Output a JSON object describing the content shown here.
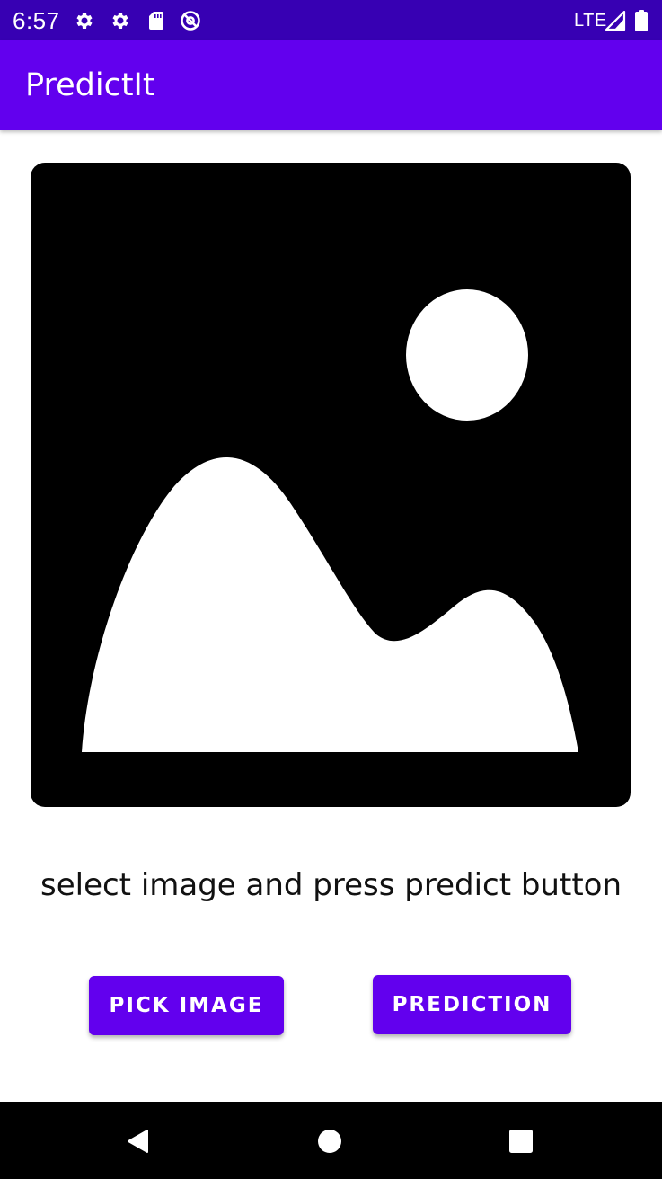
{
  "status_bar": {
    "time": "6:57",
    "network": "LTE",
    "icons": [
      "gear-icon",
      "gear-icon",
      "sd-card-icon",
      "at-sign-icon",
      "signal-icon",
      "battery-icon"
    ]
  },
  "app_bar": {
    "title": "PredictIt",
    "color": "#6200ee"
  },
  "main": {
    "image_placeholder_icon": "image-placeholder-icon",
    "instruction": "select image and press predict button"
  },
  "buttons": {
    "pick_image": "PICK IMAGE",
    "prediction": "PREDICTION"
  },
  "nav_bar": {
    "icons": [
      "back-icon",
      "home-icon",
      "recents-icon"
    ]
  },
  "colors": {
    "status_bar": "#3700b3",
    "primary": "#6200ee"
  }
}
